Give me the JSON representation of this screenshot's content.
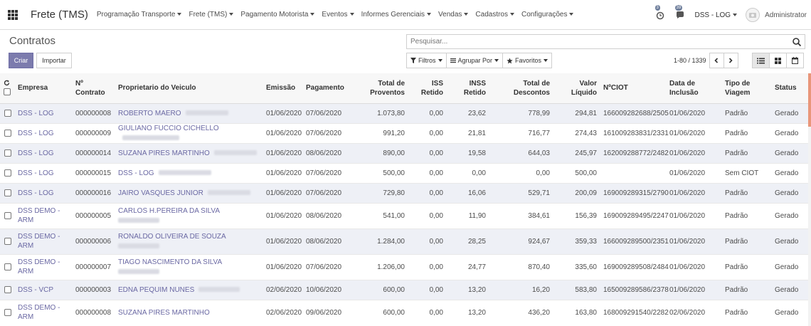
{
  "app_title": "Frete (TMS)",
  "menu": [
    "Programação Transporte",
    "Frete (TMS)",
    "Pagamento Motorista",
    "Eventos",
    "Informes Gerenciais",
    "Vendas",
    "Cadastros",
    "Configurações"
  ],
  "systray": {
    "activity_count": "3",
    "message_count": "39",
    "company": "DSS - LOG",
    "user": "Administrator"
  },
  "page_title": "Contratos",
  "search": {
    "placeholder": "Pesquisar..."
  },
  "buttons": {
    "create": "Criar",
    "import": "Importar",
    "filters": "Filtros",
    "group_by": "Agrupar Por",
    "favorites": "Favoritos"
  },
  "pager": "1-80 / 1339",
  "columns": [
    "Empresa",
    "Nº Contrato",
    "Proprietario do Veiculo",
    "Emissão",
    "Pagamento",
    "Total de Proventos",
    "ISS Retido",
    "INSS Retido",
    "Total de Descontos",
    "Valor Líquido",
    "NºCIOT",
    "Data de Inclusão",
    "Tipo de Viagem",
    "Status"
  ],
  "rows": [
    {
      "empresa": "DSS - LOG",
      "contrato": "000000008",
      "proprietario": "ROBERTO MAERO",
      "emissao": "01/06/2020",
      "pagamento": "07/06/2020",
      "proventos": "1.073,80",
      "iss": "0,00",
      "inss": "23,62",
      "descontos": "778,99",
      "liquido": "294,81",
      "ciot": "166009282688/2505",
      "inclusao": "01/06/2020",
      "tipo": "Padrão",
      "status": "Gerado"
    },
    {
      "empresa": "DSS - LOG",
      "contrato": "000000009",
      "proprietario": "GIULIANO FUCCIO CICHELLO",
      "emissao": "01/06/2020",
      "pagamento": "07/06/2020",
      "proventos": "991,20",
      "iss": "0,00",
      "inss": "21,81",
      "descontos": "716,77",
      "liquido": "274,43",
      "ciot": "161009283831/2331",
      "inclusao": "01/06/2020",
      "tipo": "Padrão",
      "status": "Gerado"
    },
    {
      "empresa": "DSS - LOG",
      "contrato": "000000014",
      "proprietario": "SUZANA PIRES MARTINHO",
      "emissao": "01/06/2020",
      "pagamento": "08/06/2020",
      "proventos": "890,00",
      "iss": "0,00",
      "inss": "19,58",
      "descontos": "644,03",
      "liquido": "245,97",
      "ciot": "162009288772/2482",
      "inclusao": "01/06/2020",
      "tipo": "Padrão",
      "status": "Gerado"
    },
    {
      "empresa": "DSS - LOG",
      "contrato": "000000015",
      "proprietario": "DSS - LOG",
      "emissao": "01/06/2020",
      "pagamento": "07/06/2020",
      "proventos": "500,00",
      "iss": "0,00",
      "inss": "0,00",
      "descontos": "0,00",
      "liquido": "500,00",
      "ciot": "",
      "inclusao": "01/06/2020",
      "tipo": "Sem CIOT",
      "status": "Gerado"
    },
    {
      "empresa": "DSS - LOG",
      "contrato": "000000016",
      "proprietario": "JAIRO VASQUES JUNIOR",
      "emissao": "01/06/2020",
      "pagamento": "07/06/2020",
      "proventos": "729,80",
      "iss": "0,00",
      "inss": "16,06",
      "descontos": "529,71",
      "liquido": "200,09",
      "ciot": "169009289315/2790",
      "inclusao": "01/06/2020",
      "tipo": "Padrão",
      "status": "Gerado"
    },
    {
      "empresa": "DSS DEMO - ARM",
      "contrato": "000000005",
      "proprietario": "CARLOS H.PEREIRA DA SILVA",
      "emissao": "01/06/2020",
      "pagamento": "08/06/2020",
      "proventos": "541,00",
      "iss": "0,00",
      "inss": "11,90",
      "descontos": "384,61",
      "liquido": "156,39",
      "ciot": "169009289495/2247",
      "inclusao": "01/06/2020",
      "tipo": "Padrão",
      "status": "Gerado"
    },
    {
      "empresa": "DSS DEMO - ARM",
      "contrato": "000000006",
      "proprietario": "RONALDO OLIVEIRA DE SOUZA",
      "emissao": "01/06/2020",
      "pagamento": "08/06/2020",
      "proventos": "1.284,00",
      "iss": "0,00",
      "inss": "28,25",
      "descontos": "924,67",
      "liquido": "359,33",
      "ciot": "166009289500/2351",
      "inclusao": "01/06/2020",
      "tipo": "Padrão",
      "status": "Gerado"
    },
    {
      "empresa": "DSS DEMO - ARM",
      "contrato": "000000007",
      "proprietario": "TIAGO NASCIMENTO DA SILVA",
      "emissao": "01/06/2020",
      "pagamento": "07/06/2020",
      "proventos": "1.206,00",
      "iss": "0,00",
      "inss": "24,77",
      "descontos": "870,40",
      "liquido": "335,60",
      "ciot": "169009289508/2484",
      "inclusao": "01/06/2020",
      "tipo": "Padrão",
      "status": "Gerado"
    },
    {
      "empresa": "DSS - VCP",
      "contrato": "000000003",
      "proprietario": "EDNA PEQUIM NUNES",
      "emissao": "02/06/2020",
      "pagamento": "10/06/2020",
      "proventos": "600,00",
      "iss": "0,00",
      "inss": "13,20",
      "descontos": "16,20",
      "liquido": "583,80",
      "ciot": "165009289586/2378",
      "inclusao": "01/06/2020",
      "tipo": "Padrão",
      "status": "Gerado"
    },
    {
      "empresa": "DSS DEMO - ARM",
      "contrato": "000000008",
      "proprietario": "SUZANA PIRES MARTINHO",
      "emissao": "02/06/2020",
      "pagamento": "09/06/2020",
      "proventos": "600,00",
      "iss": "0,00",
      "inss": "13,20",
      "descontos": "436,20",
      "liquido": "163,80",
      "ciot": "168009291540/2282",
      "inclusao": "02/06/2020",
      "tipo": "Padrão",
      "status": "Gerado"
    }
  ],
  "colors": {
    "primary": "#7c7bad",
    "link": "#6a68a3",
    "row_alt": "#eef0f6",
    "scroll_thumb": "#e9967a"
  }
}
